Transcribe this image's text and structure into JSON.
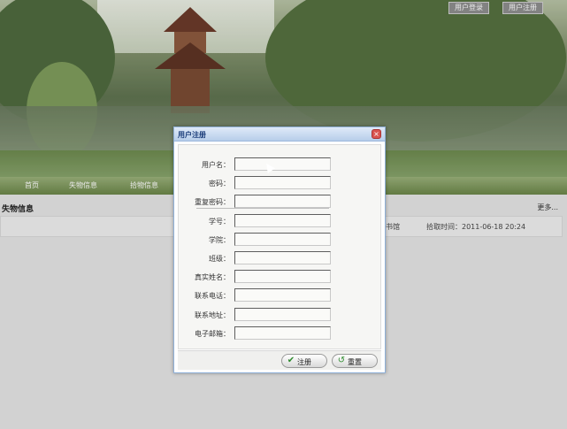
{
  "top_bar": {
    "login_label": "用户登录",
    "register_label": "用户注册"
  },
  "nav": {
    "items": [
      "首页",
      "失物信息",
      "拾物信息"
    ]
  },
  "section": {
    "title": "失物信息",
    "more": "更多..."
  },
  "info_row": {
    "place": "书馆",
    "time_label": "拾取时间：2011-06-18 20:24"
  },
  "dialog": {
    "title": "用户注册",
    "fields": [
      {
        "label": "用户名：",
        "value": ""
      },
      {
        "label": "密码：",
        "value": ""
      },
      {
        "label": "重复密码：",
        "value": ""
      },
      {
        "label": "学号：",
        "value": ""
      },
      {
        "label": "学院：",
        "value": ""
      },
      {
        "label": "班级：",
        "value": ""
      },
      {
        "label": "真实姓名：",
        "value": ""
      },
      {
        "label": "联系电话：",
        "value": ""
      },
      {
        "label": "联系地址：",
        "value": ""
      },
      {
        "label": "电子邮箱：",
        "value": ""
      }
    ],
    "submit_label": "注册",
    "reset_label": "重置"
  },
  "colors": {
    "accent": "#1b3d7a",
    "nav_green": "#6a8548",
    "close_red": "#d9534f"
  },
  "icons": {
    "close": "close-icon",
    "submit": "check-icon",
    "reset": "reset-icon"
  }
}
